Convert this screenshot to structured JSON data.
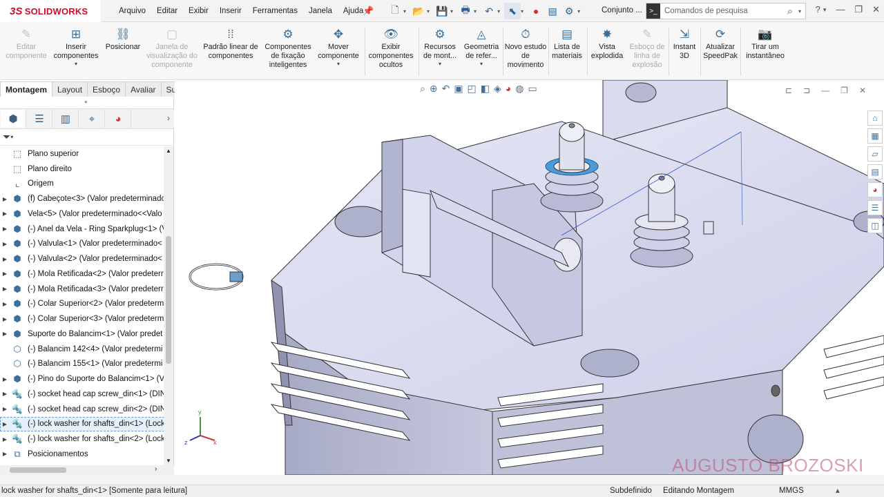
{
  "app": {
    "logo": "SOLIDWORKS",
    "logo_mark": "3S"
  },
  "menu": [
    "Arquivo",
    "Editar",
    "Exibir",
    "Inserir",
    "Ferramentas",
    "Janela",
    "Ajuda"
  ],
  "toolbar": {
    "conjunto_label": "Conjunto ...",
    "search_placeholder": "Comandos de pesquisa"
  },
  "command_manager": [
    {
      "label": "Editar componente",
      "enabled": false
    },
    {
      "label": "Inserir componentes",
      "enabled": true
    },
    {
      "label": "Posicionar",
      "enabled": true
    },
    {
      "label": "Janela de visualização do componente",
      "enabled": false
    },
    {
      "label": "Padrão linear de componentes",
      "enabled": true
    },
    {
      "label": "Componentes de fixação inteligentes",
      "enabled": true
    },
    {
      "label": "Mover componente",
      "enabled": true
    },
    {
      "label": "Exibir componentes ocultos",
      "enabled": true
    },
    {
      "label": "Recursos de mont...",
      "enabled": true
    },
    {
      "label": "Geometria de refer...",
      "enabled": true
    },
    {
      "label": "Novo estudo de movimento",
      "enabled": true
    },
    {
      "label": "Lista de materiais",
      "enabled": true
    },
    {
      "label": "Vista explodida",
      "enabled": true
    },
    {
      "label": "Esboço de linha de explosão",
      "enabled": false
    },
    {
      "label": "Instant 3D",
      "enabled": true
    },
    {
      "label": "Atualizar SpeedPak",
      "enabled": true
    },
    {
      "label": "Tirar um instantâneo",
      "enabled": true
    }
  ],
  "tabs": [
    "Montagem",
    "Layout",
    "Esboço",
    "Avaliar",
    "Suplementos do SOLIDWORKS"
  ],
  "active_tab": "Montagem",
  "feature_tree": [
    {
      "label": "Plano superior",
      "icon": "plane-icon",
      "expandable": false
    },
    {
      "label": "Plano direito",
      "icon": "plane-icon",
      "expandable": false
    },
    {
      "label": "Origem",
      "icon": "origin-icon",
      "expandable": false
    },
    {
      "label": "(f) Cabeçote<3> (Valor predeterminado",
      "icon": "part-icon",
      "expandable": true
    },
    {
      "label": "Vela<5> (Valor predeterminado<<Valo",
      "icon": "part-icon",
      "expandable": true
    },
    {
      "label": "(-) Anel da Vela - Ring Sparkplug<1> (V",
      "icon": "part-icon",
      "expandable": true
    },
    {
      "label": "(-) Valvula<1> (Valor predeterminado<",
      "icon": "part-icon",
      "expandable": true
    },
    {
      "label": "(-) Valvula<2> (Valor predeterminado<",
      "icon": "part-icon",
      "expandable": true
    },
    {
      "label": "(-) Mola Retificada<2> (Valor predeterr",
      "icon": "part-icon",
      "expandable": true
    },
    {
      "label": "(-) Mola Retificada<3> (Valor predeterr",
      "icon": "part-icon",
      "expandable": true
    },
    {
      "label": "(-) Colar Superior<2> (Valor predeterm",
      "icon": "part-icon",
      "expandable": true
    },
    {
      "label": "(-) Colar Superior<3> (Valor predeterm",
      "icon": "part-icon",
      "expandable": true
    },
    {
      "label": "Suporte do Balancim<1> (Valor predet",
      "icon": "part-icon",
      "expandable": true
    },
    {
      "label": "(-) Balancim 142<4> (Valor predetermi",
      "icon": "part-outline-icon",
      "expandable": false
    },
    {
      "label": "(-) Balancim 155<1> (Valor predetermi",
      "icon": "part-outline-icon",
      "expandable": false
    },
    {
      "label": "(-) Pino do Suporte do Balancim<1> (V",
      "icon": "part-icon",
      "expandable": true
    },
    {
      "label": "(-) socket head cap screw_din<1> (DIN",
      "icon": "screw-icon",
      "expandable": true
    },
    {
      "label": "(-) socket head cap screw_din<2> (DIN",
      "icon": "screw-icon",
      "expandable": true
    },
    {
      "label": "(-) lock washer for shafts_din<1> (Lock",
      "icon": "screw-icon",
      "expandable": true,
      "selected": true
    },
    {
      "label": "(-) lock washer for shafts_din<2> (Lock",
      "icon": "screw-icon",
      "expandable": true
    },
    {
      "label": "Posicionamentos",
      "icon": "mates-icon",
      "expandable": true
    }
  ],
  "watermark": "AUGUSTO BROZOSKI",
  "status": {
    "left": "lock washer for shafts_din<1> [Somente para leitura]",
    "state": "Subdefinido",
    "mode": "Editando Montagem",
    "units": "MMGS"
  },
  "colors": {
    "accent": "#c8102e",
    "selection": "#6b9bd1",
    "model": "#d6d8ef"
  }
}
